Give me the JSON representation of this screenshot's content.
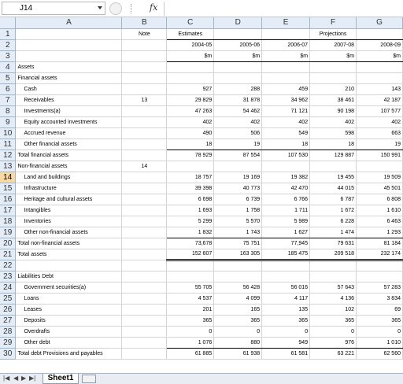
{
  "namebox": "J14",
  "sheet_tab": "Sheet1",
  "columns": [
    "A",
    "B",
    "C",
    "D",
    "E",
    "F",
    "G"
  ],
  "rows": [
    {
      "n": "1",
      "a": "",
      "b": "Note",
      "c": "Estimates",
      "d": "",
      "e": "",
      "f": "Projections",
      "g": ""
    },
    {
      "n": "2",
      "a": "",
      "b": "",
      "c": "2004-05",
      "d": "2005-06",
      "e": "2006-07",
      "f": "2007-08",
      "g": "2008-09"
    },
    {
      "n": "3",
      "a": "",
      "b": "",
      "c": "$m",
      "d": "$m",
      "e": "$m",
      "f": "$m",
      "g": "$m"
    },
    {
      "n": "4",
      "a": "Assets",
      "b": "",
      "c": "",
      "d": "",
      "e": "",
      "f": "",
      "g": ""
    },
    {
      "n": "5",
      "a": "Financial assets",
      "b": "",
      "c": "",
      "d": "",
      "e": "",
      "f": "",
      "g": ""
    },
    {
      "n": "6",
      "a": "Cash",
      "b": "",
      "c": "927",
      "d": "288",
      "e": "459",
      "f": "210",
      "g": "143"
    },
    {
      "n": "7",
      "a": "Receivables",
      "b": "13",
      "c": "29 829",
      "d": "31 878",
      "e": "34 962",
      "f": "38 461",
      "g": "42 187"
    },
    {
      "n": "8",
      "a": "Investments(a)",
      "b": "",
      "c": "47 263",
      "d": "54 462",
      "e": "71 121",
      "f": "90 198",
      "g": "107 577"
    },
    {
      "n": "9",
      "a": "Equity accounted investments",
      "b": "",
      "c": "402",
      "d": "402",
      "e": "402",
      "f": "402",
      "g": "402"
    },
    {
      "n": "10",
      "a": "Accrued revenue",
      "b": "",
      "c": "490",
      "d": "506",
      "e": "549",
      "f": "598",
      "g": "663"
    },
    {
      "n": "11",
      "a": "Other financial assets",
      "b": "",
      "c": "18",
      "d": "19",
      "e": "18",
      "f": "18",
      "g": "19"
    },
    {
      "n": "12",
      "a": "Total financial assets",
      "b": "",
      "c": "78 929",
      "d": "87 554",
      "e": "107 530",
      "f": "129 887",
      "g": "150 991"
    },
    {
      "n": "13",
      "a": "Non-financial assets",
      "b": "14",
      "c": "",
      "d": "",
      "e": "",
      "f": "",
      "g": ""
    },
    {
      "n": "14",
      "a": "Land and buildings",
      "b": "",
      "c": "18 757",
      "d": "19 169",
      "e": "19 382",
      "f": "19 455",
      "g": "19 509"
    },
    {
      "n": "15",
      "a": "Infrastructure",
      "b": "",
      "c": "39 398",
      "d": "40 773",
      "e": "42 470",
      "f": "44 015",
      "g": "45 501"
    },
    {
      "n": "16",
      "a": "Heritage and cultural assets",
      "b": "",
      "c": "6 698",
      "d": "6 739",
      "e": "6 766",
      "f": "6 787",
      "g": "6 808"
    },
    {
      "n": "17",
      "a": "Intangibles",
      "b": "",
      "c": "1 693",
      "d": "1 758",
      "e": "1 711",
      "f": "1 672",
      "g": "1 610"
    },
    {
      "n": "18",
      "a": "Inventories",
      "b": "",
      "c": "5 299",
      "d": "5 570",
      "e": "5 989",
      "f": "6 228",
      "g": "6 463"
    },
    {
      "n": "19",
      "a": "Other non-financial assets",
      "b": "",
      "c": "1 832",
      "d": "1 743",
      "e": "1 627",
      "f": "1 474",
      "g": "1 293"
    },
    {
      "n": "20",
      "a": "Total non-financial assets",
      "b": "",
      "c": "73,678",
      "d": "75 751",
      "e": "77,945",
      "f": "79 631",
      "g": "81 184"
    },
    {
      "n": "21",
      "a": "Total assets",
      "b": "",
      "c": "152 607",
      "d": "163 305",
      "e": "185 475",
      "f": "209 518",
      "g": "232 174"
    },
    {
      "n": "22",
      "a": "",
      "b": "",
      "c": "",
      "d": "",
      "e": "",
      "f": "",
      "g": ""
    },
    {
      "n": "23",
      "a": "Liabilities Debt",
      "b": "",
      "c": "",
      "d": "",
      "e": "",
      "f": "",
      "g": ""
    },
    {
      "n": "24",
      "a": "Government securities(a)",
      "b": "",
      "c": "55 705",
      "d": "56 428",
      "e": "56 016",
      "f": "57 643",
      "g": "57 283"
    },
    {
      "n": "25",
      "a": "Loans",
      "b": "",
      "c": "4 537",
      "d": "4 099",
      "e": "4 117",
      "f": "4 136",
      "g": "3 834"
    },
    {
      "n": "26",
      "a": "Leases",
      "b": "",
      "c": "201",
      "d": "165",
      "e": "135",
      "f": "102",
      "g": "69"
    },
    {
      "n": "27",
      "a": "Deposits",
      "b": "",
      "c": "365",
      "d": "365",
      "e": "365",
      "f": "365",
      "g": "365"
    },
    {
      "n": "28",
      "a": "Overdrafts",
      "b": "",
      "c": "0",
      "d": "0",
      "e": "0",
      "f": "0",
      "g": "0"
    },
    {
      "n": "29",
      "a": "Other debt",
      "b": "",
      "c": "1 076",
      "d": "880",
      "e": "949",
      "f": "976",
      "g": "1 010"
    },
    {
      "n": "30",
      "a": "Total debt Provisions and payables",
      "b": "",
      "c": "61 885",
      "d": "61 938",
      "e": "61 581",
      "f": "63 221",
      "g": "62 560"
    }
  ]
}
